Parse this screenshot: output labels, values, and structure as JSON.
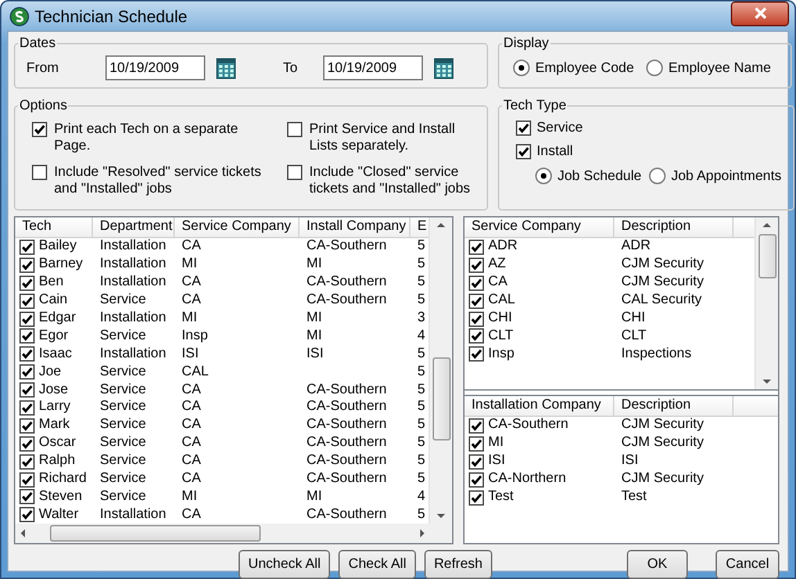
{
  "window": {
    "title": "Technician Schedule"
  },
  "dates": {
    "legend": "Dates",
    "from": {
      "label": "From",
      "value": "10/19/2009"
    },
    "to": {
      "label": "To",
      "value": "10/19/2009"
    }
  },
  "display": {
    "legend": "Display",
    "options": [
      {
        "label": "Employee Code",
        "selected": true
      },
      {
        "label": "Employee Name",
        "selected": false
      }
    ]
  },
  "options": {
    "legend": "Options",
    "items": [
      {
        "label": "Print each Tech on a separate Page.",
        "checked": true
      },
      {
        "label": "Print Service and Install Lists separately.",
        "checked": false
      },
      {
        "label": "Include \"Resolved\" service tickets and \"Installed\" jobs",
        "checked": false
      },
      {
        "label": "Include \"Closed\" service tickets and \"Installed\" jobs",
        "checked": false
      }
    ]
  },
  "tech_type": {
    "legend": "Tech Type",
    "items": [
      {
        "label": "Service",
        "checked": true
      },
      {
        "label": "Install",
        "checked": true
      }
    ],
    "modes": [
      {
        "label": "Job Schedule",
        "selected": true
      },
      {
        "label": "Job Appointments",
        "selected": false
      }
    ]
  },
  "tech_table": {
    "columns": [
      "Tech",
      "Department",
      "Service Company",
      "Install Company",
      "E"
    ],
    "rows": [
      {
        "checked": true,
        "cells": [
          "Bailey",
          "Installation",
          "CA",
          "CA-Southern",
          "5"
        ]
      },
      {
        "checked": true,
        "cells": [
          "Barney",
          "Installation",
          "MI",
          "MI",
          "5"
        ]
      },
      {
        "checked": true,
        "cells": [
          "Ben",
          "Installation",
          "CA",
          "CA-Southern",
          "5"
        ]
      },
      {
        "checked": true,
        "cells": [
          "Cain",
          "Service",
          "CA",
          "CA-Southern",
          "5"
        ]
      },
      {
        "checked": true,
        "cells": [
          "Edgar",
          "Installation",
          "MI",
          "MI",
          "3"
        ]
      },
      {
        "checked": true,
        "cells": [
          "Egor",
          "Service",
          "Insp",
          "MI",
          "4"
        ]
      },
      {
        "checked": true,
        "cells": [
          "Isaac",
          "Installation",
          "ISI",
          "ISI",
          "5"
        ]
      },
      {
        "checked": true,
        "cells": [
          "Joe",
          "Service",
          "CAL",
          "",
          "5"
        ]
      },
      {
        "checked": true,
        "cells": [
          "Jose",
          "Service",
          "CA",
          "CA-Southern",
          "5"
        ]
      },
      {
        "checked": true,
        "cells": [
          "Larry",
          "Service",
          "CA",
          "CA-Southern",
          "5"
        ]
      },
      {
        "checked": true,
        "cells": [
          "Mark",
          "Service",
          "CA",
          "CA-Southern",
          "5"
        ]
      },
      {
        "checked": true,
        "cells": [
          "Oscar",
          "Service",
          "CA",
          "CA-Southern",
          "5"
        ]
      },
      {
        "checked": true,
        "cells": [
          "Ralph",
          "Service",
          "CA",
          "CA-Southern",
          "5"
        ]
      },
      {
        "checked": true,
        "cells": [
          "Richard",
          "Service",
          "CA",
          "CA-Southern",
          "5"
        ]
      },
      {
        "checked": true,
        "cells": [
          "Steven",
          "Service",
          "MI",
          "MI",
          "4"
        ]
      },
      {
        "checked": true,
        "cells": [
          "Walter",
          "Installation",
          "CA",
          "CA-Southern",
          "5"
        ]
      }
    ]
  },
  "service_table": {
    "columns": [
      "Service Company",
      "Description"
    ],
    "rows": [
      {
        "checked": true,
        "cells": [
          "ADR",
          "ADR"
        ]
      },
      {
        "checked": true,
        "cells": [
          "AZ",
          "CJM Security"
        ]
      },
      {
        "checked": true,
        "cells": [
          "CA",
          "CJM Security"
        ]
      },
      {
        "checked": true,
        "cells": [
          "CAL",
          "CAL Security"
        ]
      },
      {
        "checked": true,
        "cells": [
          "CHI",
          "CHI"
        ]
      },
      {
        "checked": true,
        "cells": [
          "CLT",
          "CLT"
        ]
      },
      {
        "checked": true,
        "cells": [
          "Insp",
          "Inspections"
        ]
      }
    ]
  },
  "install_table": {
    "columns": [
      "Installation Company",
      "Description"
    ],
    "rows": [
      {
        "checked": true,
        "cells": [
          "CA-Southern",
          "CJM Security"
        ]
      },
      {
        "checked": true,
        "cells": [
          "MI",
          "CJM Security"
        ]
      },
      {
        "checked": true,
        "cells": [
          "ISI",
          "ISI"
        ]
      },
      {
        "checked": true,
        "cells": [
          "CA-Northern",
          "CJM Security"
        ]
      },
      {
        "checked": true,
        "cells": [
          "Test",
          "Test"
        ]
      }
    ]
  },
  "list_buttons": [
    "Uncheck All",
    "Check All",
    "Refresh"
  ],
  "dialog_buttons": [
    "OK",
    "Cancel"
  ]
}
